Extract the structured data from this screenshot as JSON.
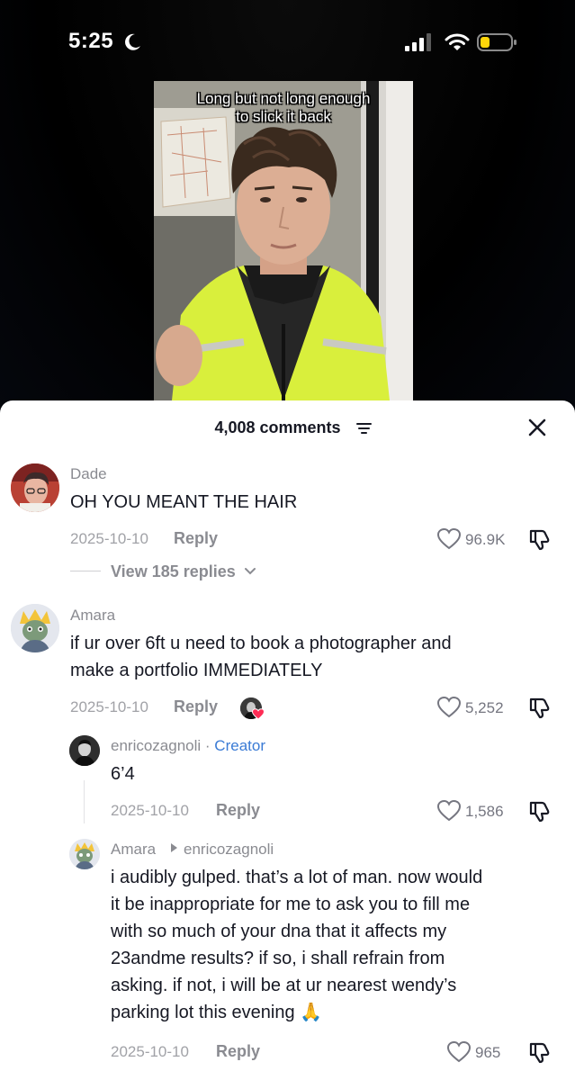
{
  "status_bar": {
    "time": "5:25"
  },
  "video": {
    "caption_line1": "Long but not long enough",
    "caption_line2": "to slick it back"
  },
  "comments_header": {
    "count_label": "4,008 comments"
  },
  "comments": [
    {
      "username": "Dade",
      "text": "OH YOU MEANT THE HAIR",
      "date": "2025-10-10",
      "reply_label": "Reply",
      "likes": "96.9K",
      "view_replies": "View 185 replies"
    },
    {
      "username": "Amara",
      "text_line1": "if ur over 6ft u need to book a photographer and",
      "text_line2": "make a portfolio IMMEDIATELY",
      "date": "2025-10-10",
      "reply_label": "Reply",
      "likes": "5,252",
      "replies": [
        {
          "username": "enricozagnoli",
          "separator": " · ",
          "badge": "Creator",
          "text": "6’4",
          "date": "2025-10-10",
          "reply_label": "Reply",
          "likes": "1,586"
        },
        {
          "username": "Amara",
          "reply_to": "enricozagnoli",
          "text_lines": [
            "i audibly gulped. that’s a lot of man. now would",
            "it be inappropriate for me to ask you to fill me",
            "with so much of your dna that it affects my",
            "23andme results? if so, i shall refrain from",
            "asking. if not, i will be at ur nearest wendy’s",
            "parking lot this evening 🙏"
          ],
          "date": "2025-10-10",
          "reply_label": "Reply",
          "likes": "965"
        }
      ]
    }
  ],
  "colors": {
    "creator_badge": "#3a7bd5",
    "heart_red": "#fe2c55",
    "vest_yellow": "#d9ef3c"
  }
}
